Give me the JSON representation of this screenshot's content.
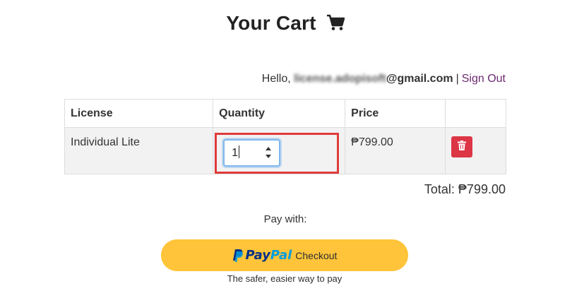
{
  "header": {
    "title": "Your Cart",
    "icon": "shopping-cart-icon"
  },
  "user": {
    "greeting": "Hello,",
    "email_hidden_part": "license.adopisoft",
    "email_domain": "@gmail.com",
    "separator": "|",
    "sign_out_label": "Sign Out"
  },
  "cart": {
    "columns": [
      "License",
      "Quantity",
      "Price",
      ""
    ],
    "rows": [
      {
        "license": "Individual Lite",
        "quantity": "1",
        "price": "₱799.00",
        "delete_icon": "trash-icon"
      }
    ],
    "total_label": "Total: ₱799.00"
  },
  "payment": {
    "pay_with_label": "Pay with:",
    "paypal_pay": "Pay",
    "paypal_pal": "Pal",
    "checkout_label": "Checkout",
    "tagline": "The safer, easier way to pay"
  },
  "colors": {
    "delete_button": "#dc3545",
    "paypal_button": "#ffc439",
    "highlight_box": "#e03b3b",
    "link": "#6b2a6f"
  }
}
